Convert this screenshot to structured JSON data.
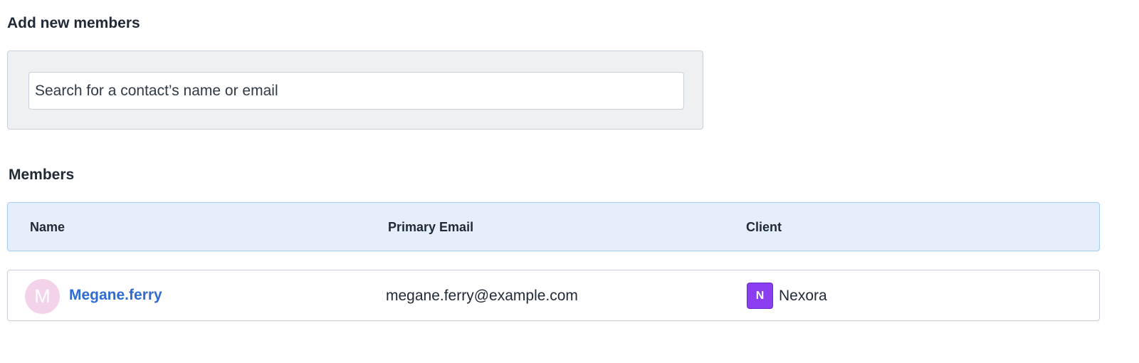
{
  "add_section": {
    "title": "Add new members",
    "search_placeholder": "Search for a contact’s name or email",
    "search_value": ""
  },
  "members_section": {
    "title": "Members",
    "columns": [
      "Name",
      "Primary Email",
      "Client"
    ],
    "rows": [
      {
        "avatar_initial": "M",
        "name": "Megane.ferry",
        "email": "megane.ferry@example.com",
        "client_initial": "N",
        "client": "Nexora"
      }
    ]
  },
  "colors": {
    "link": "#2f6bd0",
    "header_bg": "#e4effb",
    "avatar_bg": "#f3d3ea",
    "client_badge_bg": "#8a3ef0"
  }
}
